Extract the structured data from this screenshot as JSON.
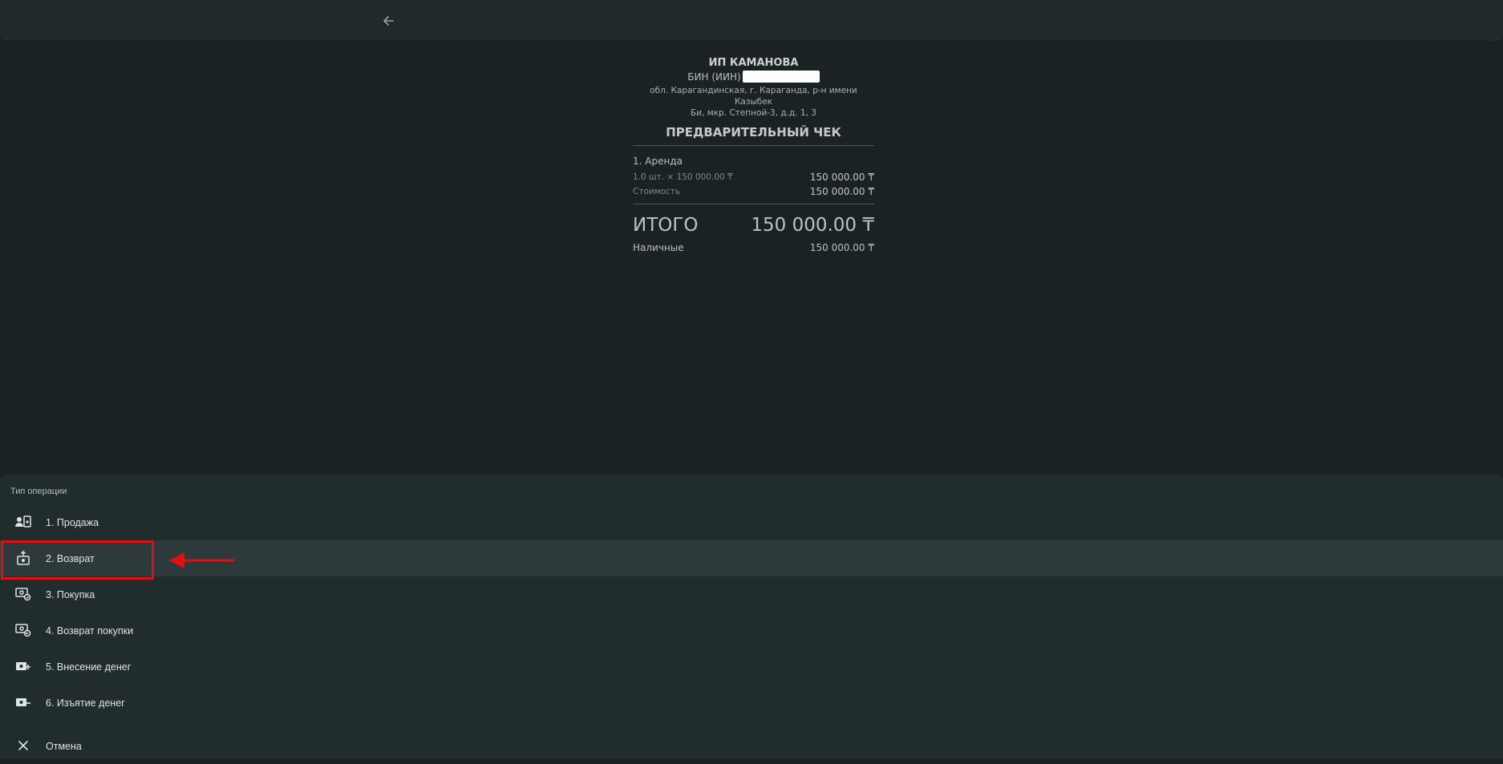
{
  "topbar": {
    "back_icon": "arrow-left-icon"
  },
  "receipt": {
    "org_name": "ИП КАМАНОВА",
    "bin_label": "БИН (ИИН)",
    "address_line1": "обл. Карагандинская, г. Караганда, р-н имени Казыбек",
    "address_line2": "Би, мкр. Степной-3, д.д. 1, 3",
    "title": "ПРЕДВАРИТЕЛЬНЫЙ ЧЕК",
    "item_name": "1. Аренда",
    "qty_label": "1.0 шт. × 150 000.00 ₸",
    "qty_value": "150 000.00 ₸",
    "cost_label": "Стоимость",
    "cost_value": "150 000.00 ₸",
    "total_label": "ИТОГО",
    "total_value": "150 000.00 ₸",
    "payment_label": "Наличные",
    "payment_value": "150 000.00 ₸"
  },
  "sheet": {
    "title": "Тип операции",
    "options": [
      {
        "label": "1. Продажа",
        "icon": "sale-icon"
      },
      {
        "label": "2. Возврат",
        "icon": "refund-icon",
        "selected": true
      },
      {
        "label": "3. Покупка",
        "icon": "purchase-icon"
      },
      {
        "label": "4. Возврат покупки",
        "icon": "purchase-return-icon"
      },
      {
        "label": "5. Внесение денег",
        "icon": "cash-in-icon"
      },
      {
        "label": "6. Изъятие денег",
        "icon": "cash-out-icon"
      }
    ],
    "cancel_label": "Отмена",
    "cancel_icon": "close-icon"
  },
  "annotation": {
    "color": "#e01010"
  }
}
